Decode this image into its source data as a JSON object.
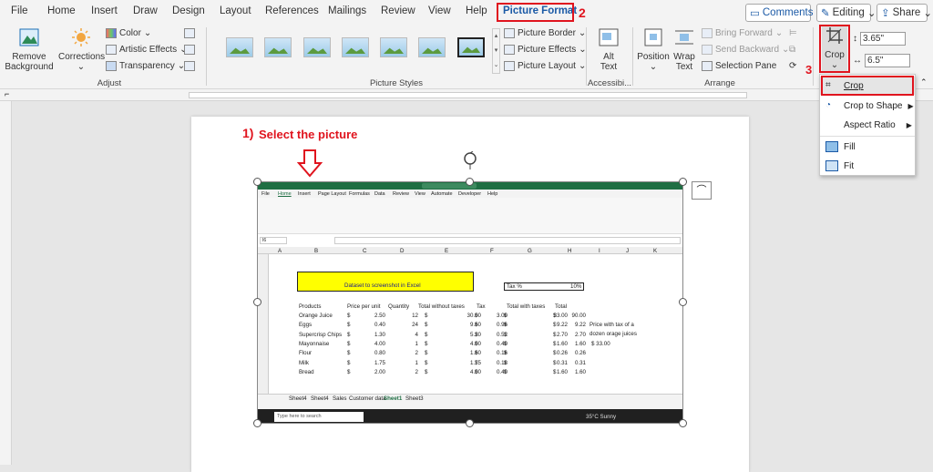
{
  "tabs": [
    "File",
    "Home",
    "Insert",
    "Draw",
    "Design",
    "Layout",
    "References",
    "Mailings",
    "Review",
    "View",
    "Help",
    "Picture Format"
  ],
  "top_buttons": {
    "comments": "Comments",
    "editing": "Editing",
    "share": "Share"
  },
  "annotations": {
    "step1": "1)",
    "step1_text": "Select the picture",
    "step2": "2",
    "step3": "3"
  },
  "adjust": {
    "remove_bg": [
      "Remove",
      "Background"
    ],
    "corrections": "Corrections",
    "color": "Color",
    "artistic": "Artistic Effects",
    "transparency": "Transparency",
    "label": "Adjust"
  },
  "styles": {
    "border": "Picture Border",
    "effects": "Picture Effects",
    "layout": "Picture Layout",
    "label": "Picture Styles"
  },
  "access": {
    "alt": [
      "Alt",
      "Text"
    ],
    "label": "Accessibi..."
  },
  "arrange": {
    "position": "Position",
    "wrap": [
      "Wrap",
      "Text"
    ],
    "forward": "Bring Forward",
    "backward": "Send Backward",
    "pane": "Selection Pane",
    "label": "Arrange"
  },
  "size": {
    "crop": "Crop",
    "height": "3.65\"",
    "width": "6.5\""
  },
  "crop_menu": [
    "Crop",
    "Crop to Shape",
    "Aspect Ratio",
    "Fill",
    "Fit"
  ],
  "excel": {
    "title": "Dataset to screenshot in Excel",
    "tax_label": "Tax %",
    "tax_value": "10%",
    "headers": [
      "Products",
      "Price per unit",
      "Quantity",
      "Total without taxes",
      "Tax",
      "Total with taxes",
      "Total"
    ],
    "rows": [
      [
        "Orange Juice",
        "$",
        "2.50",
        "12",
        "$",
        "30.00",
        "$",
        "3.00",
        "$",
        "33.00",
        "$",
        "90.00"
      ],
      [
        "Eggs",
        "$",
        "0.40",
        "24",
        "$",
        "9.60",
        "$",
        "0.96",
        "$",
        "9.22",
        "$",
        "9.22"
      ],
      [
        "Supercrisp Chips",
        "$",
        "1.30",
        "4",
        "$",
        "5.20",
        "$",
        "0.52",
        "$",
        "2.70",
        "$",
        "2.70"
      ],
      [
        "Mayonnaise",
        "$",
        "4.00",
        "1",
        "$",
        "4.00",
        "$",
        "0.40",
        "$",
        "1.60",
        "$",
        "1.60"
      ],
      [
        "Flour",
        "$",
        "0.80",
        "2",
        "$",
        "1.60",
        "$",
        "0.16",
        "$",
        "0.26",
        "$",
        "0.26"
      ],
      [
        "Milk",
        "$",
        "1.75",
        "1",
        "$",
        "1.75",
        "$",
        "0.18",
        "$",
        "0.31",
        "$",
        "0.31"
      ],
      [
        "Bread",
        "$",
        "2.00",
        "2",
        "$",
        "4.00",
        "$",
        "0.40",
        "$",
        "1.60",
        "$",
        "1.60"
      ]
    ],
    "note": [
      "Price with tax of a",
      "dozen orage juices",
      "$  33.00"
    ],
    "col_letters": [
      "A",
      "B",
      "C",
      "D",
      "E",
      "F",
      "G",
      "H",
      "I",
      "J",
      "K"
    ],
    "sheets": [
      "Sheet4",
      "Sheet4",
      "Sales",
      "Customer data",
      "Sheet1",
      "Sheet3"
    ],
    "tabs": [
      "File",
      "Home",
      "Insert",
      "Page Layout",
      "Formulas",
      "Data",
      "Review",
      "View",
      "Automate",
      "Developer",
      "Help"
    ],
    "search": "Type here to search",
    "weather": "35°C  Sunny",
    "namebox": "I6"
  }
}
